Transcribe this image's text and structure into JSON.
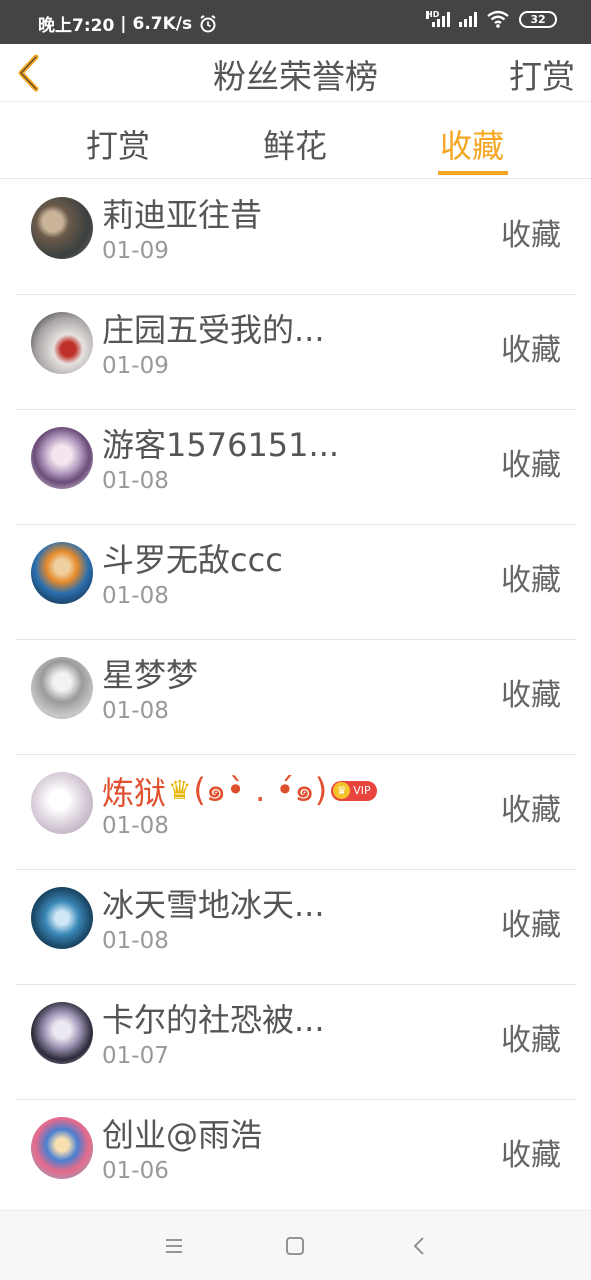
{
  "status_bar": {
    "time": "晚上7:20",
    "net_speed": "6.7K/s",
    "hd": "HD",
    "battery": "32"
  },
  "header": {
    "title": "粉丝荣誉榜",
    "right_action": "打赏",
    "back_icon": "chevron-left-icon"
  },
  "tabs": [
    {
      "label": "打赏",
      "active": false
    },
    {
      "label": "鲜花",
      "active": false
    },
    {
      "label": "收藏",
      "active": true
    }
  ],
  "colors": {
    "accent": "#f5a623",
    "vip_name": "#e0502e",
    "status_bar": "#444444"
  },
  "fans": [
    {
      "name": "莉迪亚往昔",
      "date": "01-09",
      "action": "收藏"
    },
    {
      "name": "庄园五受我的...",
      "date": "01-09",
      "action": "收藏"
    },
    {
      "name": "游客1576151...",
      "date": "01-08",
      "action": "收藏"
    },
    {
      "name": "斗罗无敌ccc",
      "date": "01-08",
      "action": "收藏"
    },
    {
      "name": "星梦梦",
      "date": "01-08",
      "action": "收藏"
    },
    {
      "name": "炼狱",
      "name_suffix": "(๑•̀ . •́๑)",
      "date": "01-08",
      "action": "收藏",
      "vip": true,
      "vip_label": "VIP"
    },
    {
      "name": "冰天雪地冰天...",
      "date": "01-08",
      "action": "收藏"
    },
    {
      "name": "卡尔的社恐被...",
      "date": "01-07",
      "action": "收藏"
    },
    {
      "name": "创业@雨浩",
      "date": "01-06",
      "action": "收藏"
    }
  ],
  "nav_bar": {
    "menu_icon": "menu-icon",
    "home_icon": "home-square-icon",
    "back_icon": "back-triangle-icon"
  }
}
